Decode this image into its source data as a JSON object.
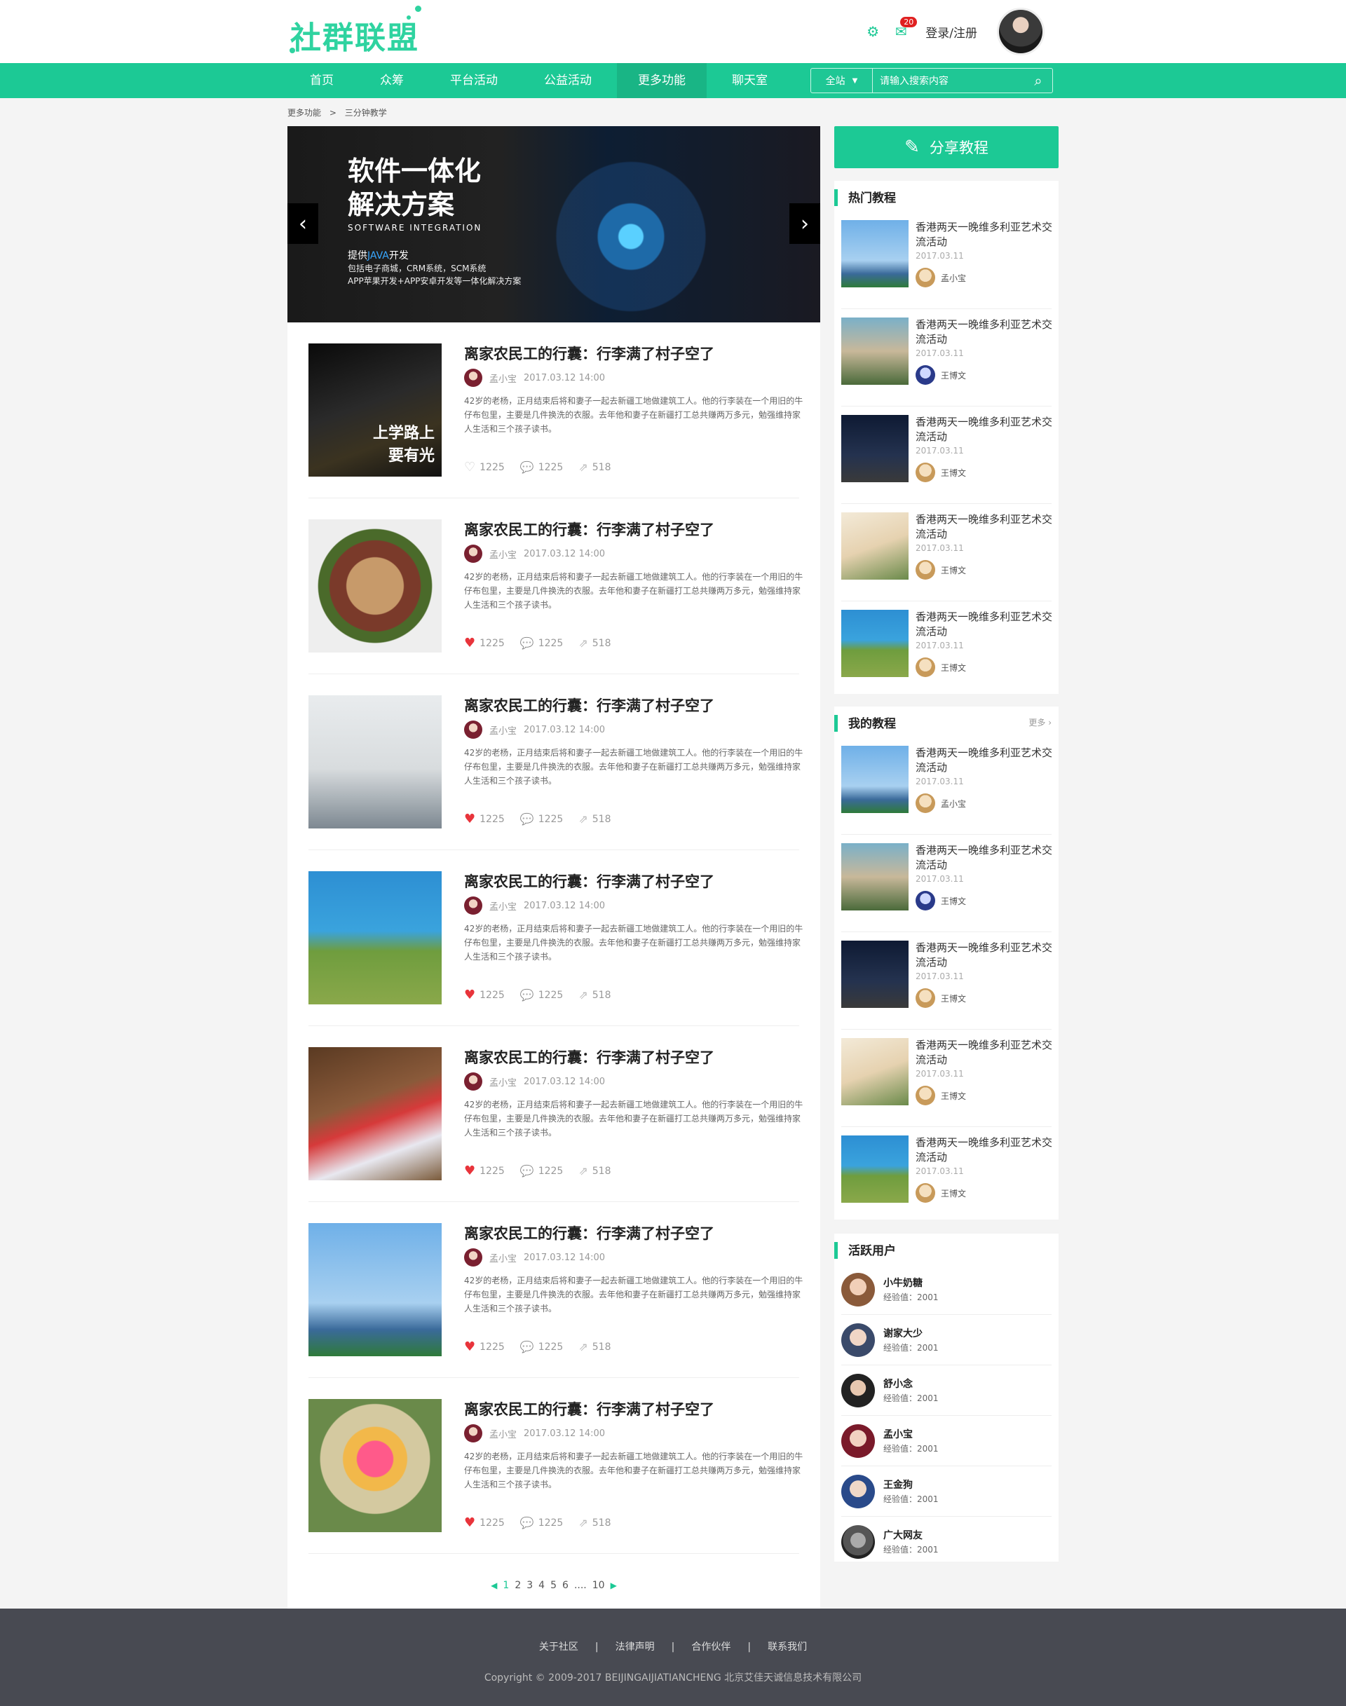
{
  "header": {
    "logo": "社群联盟",
    "settings_icon": "gear-icon",
    "message_icon": "mail-icon",
    "message_count": "20",
    "login_label": "登录/注册"
  },
  "nav": {
    "items": [
      "首页",
      "众筹",
      "平台活动",
      "公益活动",
      "更多功能",
      "聊天室"
    ],
    "active_index": 4,
    "search_scope": "全站",
    "search_placeholder": "请输入搜索内容"
  },
  "breadcrumb": {
    "parent": "更多功能",
    "separator": ">",
    "current": "三分钟教学"
  },
  "banner": {
    "title_line1": "软件一体化",
    "title_line2": "解决方案",
    "subtitle_en": "SOFTWARE INTEGRATION",
    "line1_prefix": "提供",
    "line1_java": "JAVA",
    "line1_suffix": "开发",
    "line2": "包括电子商城，CRM系统，SCM系统",
    "line3": "APP苹果开发+APP安卓开发等一体化解决方案",
    "prev": "‹",
    "next": "›"
  },
  "articles": [
    {
      "title": "离家农民工的行囊：行李满了村子空了",
      "author": "孟小宝",
      "date": "2017.03.12  14:00",
      "desc": "42岁的老杨，正月结束后将和妻子一起去新疆工地做建筑工人。他的行李装在一个用旧的牛仔布包里，主要是几件换洗的衣服。去年他和妻子在新疆打工总共赚两万多元，勉强维持家人生活和三个孩子读书。",
      "likes": "1225",
      "comments": "1225",
      "shares": "518",
      "liked": false,
      "thumb_caption": "上学路上 要有光"
    },
    {
      "title": "离家农民工的行囊：行李满了村子空了",
      "author": "孟小宝",
      "date": "2017.03.12  14:00",
      "desc": "42岁的老杨，正月结束后将和妻子一起去新疆工地做建筑工人。他的行李装在一个用旧的牛仔布包里，主要是几件换洗的衣服。去年他和妻子在新疆打工总共赚两万多元，勉强维持家人生活和三个孩子读书。",
      "likes": "1225",
      "comments": "1225",
      "shares": "518",
      "liked": true
    },
    {
      "title": "离家农民工的行囊：行李满了村子空了",
      "author": "孟小宝",
      "date": "2017.03.12  14:00",
      "desc": "42岁的老杨，正月结束后将和妻子一起去新疆工地做建筑工人。他的行李装在一个用旧的牛仔布包里，主要是几件换洗的衣服。去年他和妻子在新疆打工总共赚两万多元，勉强维持家人生活和三个孩子读书。",
      "likes": "1225",
      "comments": "1225",
      "shares": "518",
      "liked": true
    },
    {
      "title": "离家农民工的行囊：行李满了村子空了",
      "author": "孟小宝",
      "date": "2017.03.12  14:00",
      "desc": "42岁的老杨，正月结束后将和妻子一起去新疆工地做建筑工人。他的行李装在一个用旧的牛仔布包里，主要是几件换洗的衣服。去年他和妻子在新疆打工总共赚两万多元，勉强维持家人生活和三个孩子读书。",
      "likes": "1225",
      "comments": "1225",
      "shares": "518",
      "liked": true
    },
    {
      "title": "离家农民工的行囊：行李满了村子空了",
      "author": "孟小宝",
      "date": "2017.03.12  14:00",
      "desc": "42岁的老杨，正月结束后将和妻子一起去新疆工地做建筑工人。他的行李装在一个用旧的牛仔布包里，主要是几件换洗的衣服。去年他和妻子在新疆打工总共赚两万多元，勉强维持家人生活和三个孩子读书。",
      "likes": "1225",
      "comments": "1225",
      "shares": "518",
      "liked": true
    },
    {
      "title": "离家农民工的行囊：行李满了村子空了",
      "author": "孟小宝",
      "date": "2017.03.12  14:00",
      "desc": "42岁的老杨，正月结束后将和妻子一起去新疆工地做建筑工人。他的行李装在一个用旧的牛仔布包里，主要是几件换洗的衣服。去年他和妻子在新疆打工总共赚两万多元，勉强维持家人生活和三个孩子读书。",
      "likes": "1225",
      "comments": "1225",
      "shares": "518",
      "liked": true
    },
    {
      "title": "离家农民工的行囊：行李满了村子空了",
      "author": "孟小宝",
      "date": "2017.03.12  14:00",
      "desc": "42岁的老杨，正月结束后将和妻子一起去新疆工地做建筑工人。他的行李装在一个用旧的牛仔布包里，主要是几件换洗的衣服。去年他和妻子在新疆打工总共赚两万多元，勉强维持家人生活和三个孩子读书。",
      "likes": "1225",
      "comments": "1225",
      "shares": "518",
      "liked": true
    }
  ],
  "pagination": {
    "prev": "◀",
    "current": "1",
    "pages": [
      "2",
      "3",
      "4",
      "5",
      "6"
    ],
    "ellipsis": "....",
    "last": "10",
    "next": "▶"
  },
  "sidebar": {
    "share_label": "分享教程",
    "hot": {
      "title": "热门教程",
      "items": [
        {
          "title": "香港两天一晚维多利亚艺术交流活动",
          "date": "2017.03.11",
          "user": "孟小宝"
        },
        {
          "title": "香港两天一晚维多利亚艺术交流活动",
          "date": "2017.03.11",
          "user": "王博文"
        },
        {
          "title": "香港两天一晚维多利亚艺术交流活动",
          "date": "2017.03.11",
          "user": "王博文"
        },
        {
          "title": "香港两天一晚维多利亚艺术交流活动",
          "date": "2017.03.11",
          "user": "王博文"
        },
        {
          "title": "香港两天一晚维多利亚艺术交流活动",
          "date": "2017.03.11",
          "user": "王博文"
        }
      ]
    },
    "mine": {
      "title": "我的教程",
      "more": "更多 ›",
      "items": [
        {
          "title": "香港两天一晚维多利亚艺术交流活动",
          "date": "2017.03.11",
          "user": "孟小宝"
        },
        {
          "title": "香港两天一晚维多利亚艺术交流活动",
          "date": "2017.03.11",
          "user": "王博文"
        },
        {
          "title": "香港两天一晚维多利亚艺术交流活动",
          "date": "2017.03.11",
          "user": "王博文"
        },
        {
          "title": "香港两天一晚维多利亚艺术交流活动",
          "date": "2017.03.11",
          "user": "王博文"
        },
        {
          "title": "香港两天一晚维多利亚艺术交流活动",
          "date": "2017.03.11",
          "user": "王博文"
        }
      ]
    },
    "active": {
      "title": "活跃用户",
      "users": [
        {
          "name": "小牛奶糖",
          "exp": "经验值：2001"
        },
        {
          "name": "谢家大少",
          "exp": "经验值：2001"
        },
        {
          "name": "舒小念",
          "exp": "经验值：2001"
        },
        {
          "name": "孟小宝",
          "exp": "经验值：2001"
        },
        {
          "name": "王金狗",
          "exp": "经验值：2001"
        },
        {
          "name": "广大网友",
          "exp": "经验值：2001"
        }
      ]
    }
  },
  "footer": {
    "links": [
      "关于社区",
      "法律声明",
      "合作伙伴",
      "联系我们"
    ],
    "separator": "|",
    "copyright": "Copyright © 2009-2017 BEIJINGAIJIATIANCHENG 北京艾佳天诚信息技术有限公司"
  },
  "colors": {
    "accent": "#1cc995",
    "like": "#e8343b",
    "footer_bg": "#484a52"
  }
}
